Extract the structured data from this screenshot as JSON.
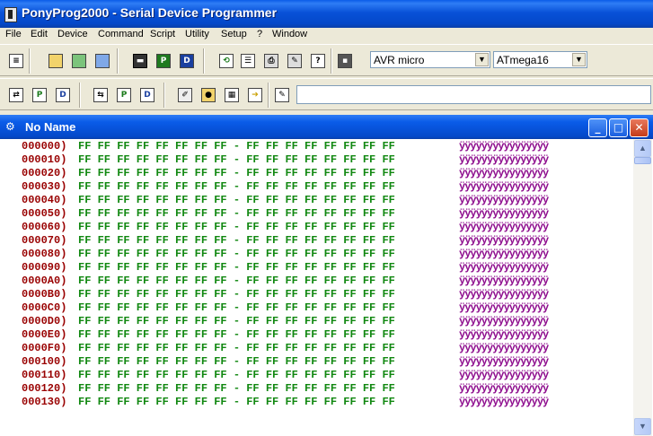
{
  "app": {
    "window_title": "PonyProg2000 - Serial Device Programmer"
  },
  "menu": [
    "File",
    "Edit",
    "Device",
    "Command",
    "Script",
    "Utility",
    "Setup",
    "?",
    "Window"
  ],
  "toolbar": {
    "device_family": "AVR micro",
    "device_model": "ATmega16",
    "script_value": ""
  },
  "document": {
    "title": "No Name",
    "rows": [
      {
        "addr": "000000)",
        "hex": "FF FF FF FF FF FF FF FF - FF FF FF FF FF FF FF FF",
        "ascii": "ÿÿÿÿÿÿÿÿÿÿÿÿÿÿÿÿ"
      },
      {
        "addr": "000010)",
        "hex": "FF FF FF FF FF FF FF FF - FF FF FF FF FF FF FF FF",
        "ascii": "ÿÿÿÿÿÿÿÿÿÿÿÿÿÿÿÿ"
      },
      {
        "addr": "000020)",
        "hex": "FF FF FF FF FF FF FF FF - FF FF FF FF FF FF FF FF",
        "ascii": "ÿÿÿÿÿÿÿÿÿÿÿÿÿÿÿÿ"
      },
      {
        "addr": "000030)",
        "hex": "FF FF FF FF FF FF FF FF - FF FF FF FF FF FF FF FF",
        "ascii": "ÿÿÿÿÿÿÿÿÿÿÿÿÿÿÿÿ"
      },
      {
        "addr": "000040)",
        "hex": "FF FF FF FF FF FF FF FF - FF FF FF FF FF FF FF FF",
        "ascii": "ÿÿÿÿÿÿÿÿÿÿÿÿÿÿÿÿ"
      },
      {
        "addr": "000050)",
        "hex": "FF FF FF FF FF FF FF FF - FF FF FF FF FF FF FF FF",
        "ascii": "ÿÿÿÿÿÿÿÿÿÿÿÿÿÿÿÿ"
      },
      {
        "addr": "000060)",
        "hex": "FF FF FF FF FF FF FF FF - FF FF FF FF FF FF FF FF",
        "ascii": "ÿÿÿÿÿÿÿÿÿÿÿÿÿÿÿÿ"
      },
      {
        "addr": "000070)",
        "hex": "FF FF FF FF FF FF FF FF - FF FF FF FF FF FF FF FF",
        "ascii": "ÿÿÿÿÿÿÿÿÿÿÿÿÿÿÿÿ"
      },
      {
        "addr": "000080)",
        "hex": "FF FF FF FF FF FF FF FF - FF FF FF FF FF FF FF FF",
        "ascii": "ÿÿÿÿÿÿÿÿÿÿÿÿÿÿÿÿ"
      },
      {
        "addr": "000090)",
        "hex": "FF FF FF FF FF FF FF FF - FF FF FF FF FF FF FF FF",
        "ascii": "ÿÿÿÿÿÿÿÿÿÿÿÿÿÿÿÿ"
      },
      {
        "addr": "0000A0)",
        "hex": "FF FF FF FF FF FF FF FF - FF FF FF FF FF FF FF FF",
        "ascii": "ÿÿÿÿÿÿÿÿÿÿÿÿÿÿÿÿ"
      },
      {
        "addr": "0000B0)",
        "hex": "FF FF FF FF FF FF FF FF - FF FF FF FF FF FF FF FF",
        "ascii": "ÿÿÿÿÿÿÿÿÿÿÿÿÿÿÿÿ"
      },
      {
        "addr": "0000C0)",
        "hex": "FF FF FF FF FF FF FF FF - FF FF FF FF FF FF FF FF",
        "ascii": "ÿÿÿÿÿÿÿÿÿÿÿÿÿÿÿÿ"
      },
      {
        "addr": "0000D0)",
        "hex": "FF FF FF FF FF FF FF FF - FF FF FF FF FF FF FF FF",
        "ascii": "ÿÿÿÿÿÿÿÿÿÿÿÿÿÿÿÿ"
      },
      {
        "addr": "0000E0)",
        "hex": "FF FF FF FF FF FF FF FF - FF FF FF FF FF FF FF FF",
        "ascii": "ÿÿÿÿÿÿÿÿÿÿÿÿÿÿÿÿ"
      },
      {
        "addr": "0000F0)",
        "hex": "FF FF FF FF FF FF FF FF - FF FF FF FF FF FF FF FF",
        "ascii": "ÿÿÿÿÿÿÿÿÿÿÿÿÿÿÿÿ"
      },
      {
        "addr": "000100)",
        "hex": "FF FF FF FF FF FF FF FF - FF FF FF FF FF FF FF FF",
        "ascii": "ÿÿÿÿÿÿÿÿÿÿÿÿÿÿÿÿ"
      },
      {
        "addr": "000110)",
        "hex": "FF FF FF FF FF FF FF FF - FF FF FF FF FF FF FF FF",
        "ascii": "ÿÿÿÿÿÿÿÿÿÿÿÿÿÿÿÿ"
      },
      {
        "addr": "000120)",
        "hex": "FF FF FF FF FF FF FF FF - FF FF FF FF FF FF FF FF",
        "ascii": "ÿÿÿÿÿÿÿÿÿÿÿÿÿÿÿÿ"
      },
      {
        "addr": "000130)",
        "hex": "FF FF FF FF FF FF FF FF - FF FF FF FF FF FF FF FF",
        "ascii": "ÿÿÿÿÿÿÿÿÿÿÿÿÿÿÿÿ"
      }
    ]
  },
  "colors": {
    "address": "#990000",
    "hex": "#118811",
    "ascii": "#8e0e8e",
    "titlebar": "#0a5ce8"
  }
}
